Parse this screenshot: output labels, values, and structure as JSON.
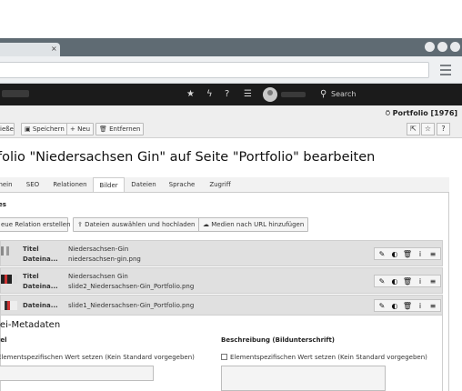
{
  "browser": {
    "tab_close": "×",
    "menu_icon": "hamburger-icon"
  },
  "topbar": {
    "search_label": "Search",
    "icons": [
      "star-icon",
      "bolt-icon",
      "help-icon",
      "list-icon"
    ]
  },
  "docheader": {
    "buttons": {
      "close": "ießen",
      "save": "Speichern",
      "new": "Neu",
      "delete": "Entfernen"
    },
    "record_title": "Portfolio [1976]",
    "record_icon": "flask-icon"
  },
  "page": {
    "title": "folio \"Niedersachsen Gin\" auf Seite \"Portfolio\" bearbeiten"
  },
  "tabs": [
    {
      "label": "nein",
      "active": false
    },
    {
      "label": "SEO",
      "active": false
    },
    {
      "label": "Relationen",
      "active": false
    },
    {
      "label": "Bilder",
      "active": true
    },
    {
      "label": "Dateien",
      "active": false
    },
    {
      "label": "Sprache",
      "active": false
    },
    {
      "label": "Zugriff",
      "active": false
    }
  ],
  "images": {
    "section_label": "es",
    "actions": {
      "new_relation": "eue Relation erstellen",
      "upload": "Dateien auswählen und hochladen",
      "url": "Medien nach URL hinzufügen"
    },
    "rows": [
      {
        "title_label": "Titel",
        "file_label": "Dateina...",
        "title_value": "Niedersachsen-Gin",
        "file_value": "niedersachsen-gin.png"
      },
      {
        "title_label": "Titel",
        "file_label": "Dateina...",
        "title_value": "Niedersachsen Gin",
        "file_value": "slide2_Niedersachsen-Gin_Portfolio.png"
      },
      {
        "title_label": "",
        "file_label": "Dateina...",
        "title_value": "",
        "file_value": "slide1_Niedersachsen-Gin_Portfolio.png"
      }
    ]
  },
  "metadata": {
    "title": "tei-Metadaten",
    "left_label": "tel",
    "left_checkbox": "Elementspezifischen Wert setzen (Kein Standard vorgegeben)",
    "right_label": "Beschreibung (Bildunterschrift)",
    "right_checkbox": "Elementspezifischen Wert setzen (Kein Standard vorgegeben)"
  }
}
